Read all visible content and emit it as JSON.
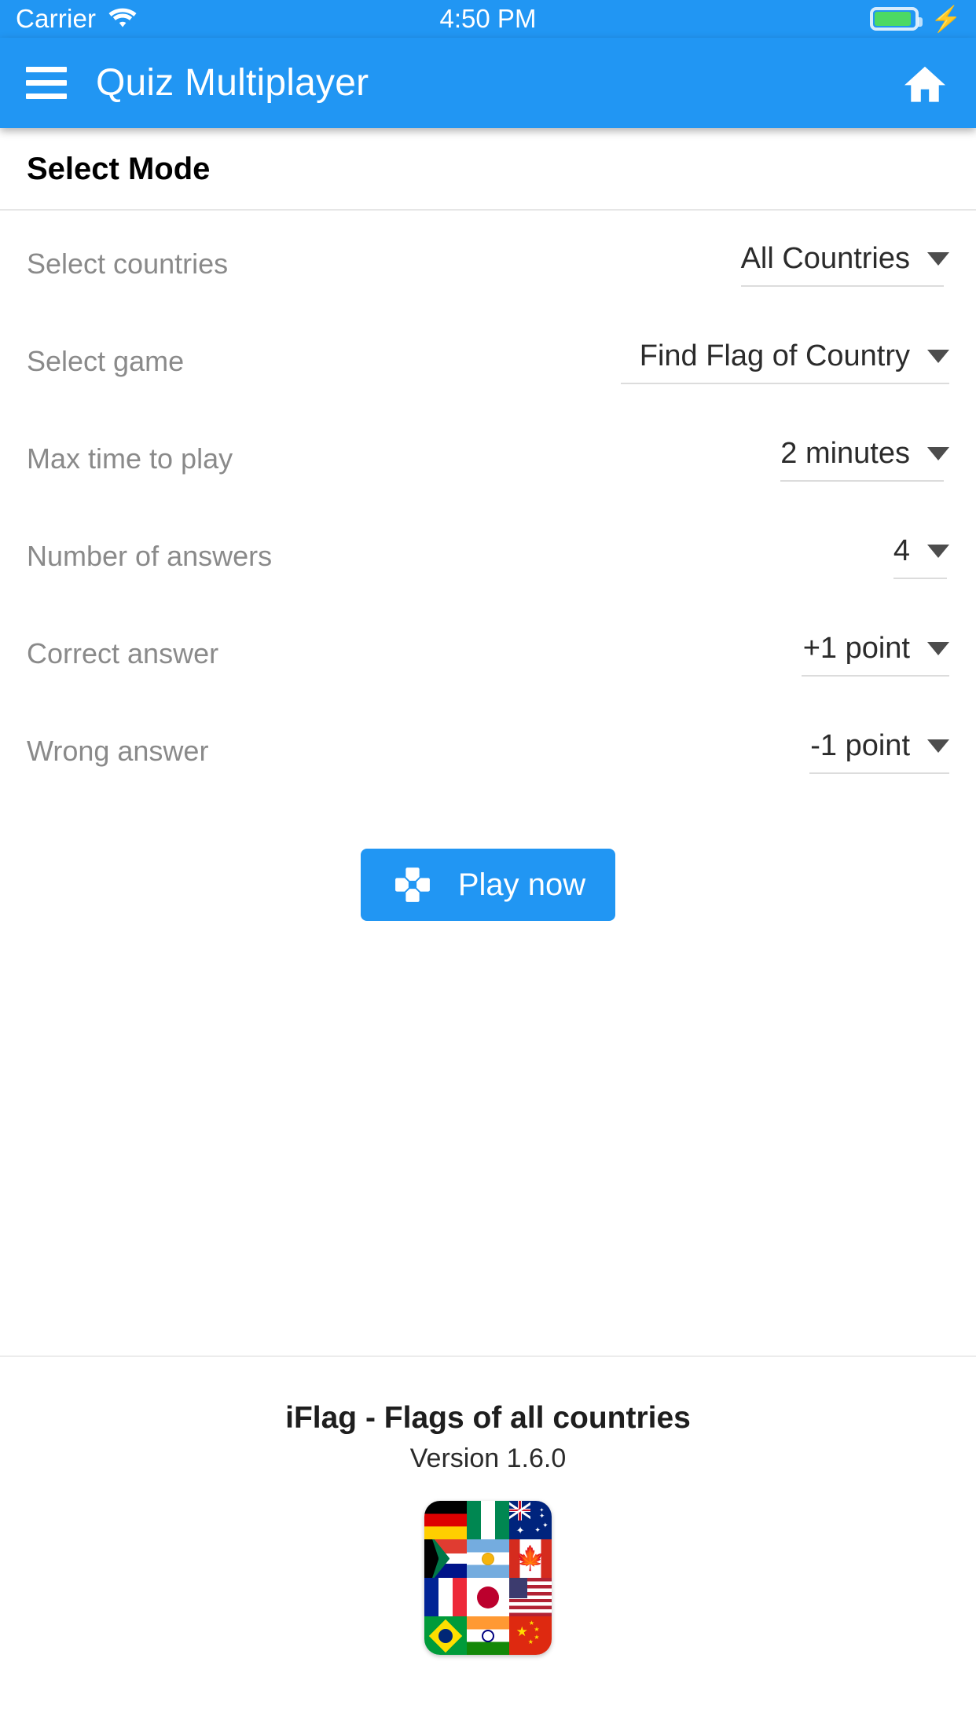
{
  "status_bar": {
    "carrier": "Carrier",
    "wifi_icon": "wifi-icon",
    "time": "4:50 PM",
    "battery_icon": "battery-full-icon",
    "charging_icon": "lightning-bolt-icon"
  },
  "app_bar": {
    "menu_icon": "hamburger-menu-icon",
    "title": "Quiz Multiplayer",
    "home_icon": "home-icon"
  },
  "section": {
    "title": "Select Mode"
  },
  "settings": {
    "rows": [
      {
        "label": "Select countries",
        "value": "All Countries",
        "caret_icon": "chevron-down-icon",
        "underline_class": "f-countries"
      },
      {
        "label": "Select game",
        "value": "Find Flag of Country",
        "caret_icon": "chevron-down-icon",
        "underline_class": "f-game"
      },
      {
        "label": "Max time to play",
        "value": "2 minutes",
        "caret_icon": "chevron-down-icon",
        "underline_class": "f-time"
      },
      {
        "label": "Number of answers",
        "value": "4",
        "caret_icon": "chevron-down-icon",
        "underline_class": "f-answers"
      },
      {
        "label": "Correct answer",
        "value": "+1 point",
        "caret_icon": "chevron-down-icon",
        "underline_class": "f-correct"
      },
      {
        "label": "Wrong answer",
        "value": "-1 point",
        "caret_icon": "chevron-down-icon",
        "underline_class": "f-wrong"
      }
    ]
  },
  "play_button": {
    "label": "Play now",
    "icon": "gamepad-dpad-icon"
  },
  "footer": {
    "app_name": "iFlag - Flags of all countries",
    "version": "Version 1.6.0",
    "app_icon": "flags-grid-app-icon",
    "flags": [
      "germany",
      "nigeria",
      "australia",
      "south-africa",
      "argentina",
      "canada",
      "france",
      "japan",
      "united-states",
      "brazil",
      "india",
      "china"
    ]
  },
  "colors": {
    "accent": "#2196f3",
    "label_gray": "#8a8a8a",
    "value_dark": "#2b2b2b",
    "battery_green": "#4cd964"
  }
}
